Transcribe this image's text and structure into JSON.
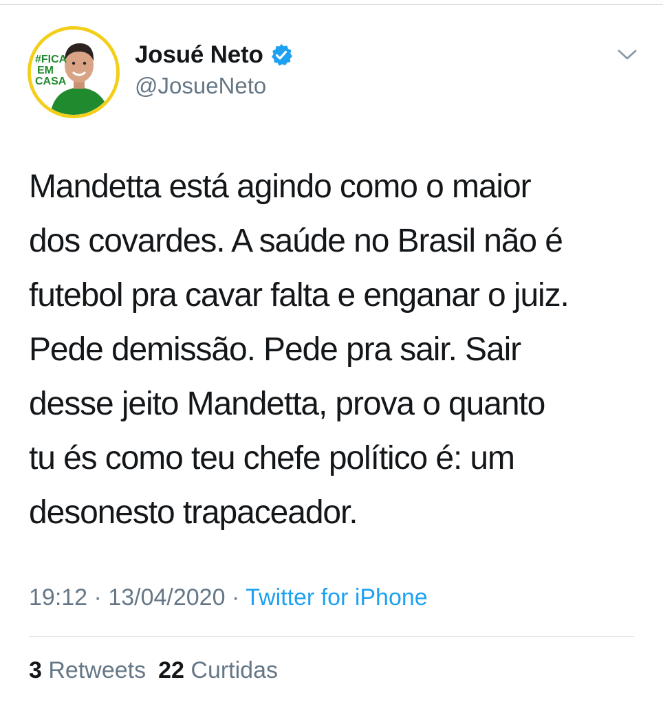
{
  "author": {
    "display_name": "Josué Neto",
    "handle": "@JosueNeto",
    "verified": true,
    "avatar_text": [
      "#FICA",
      "EM",
      "CASA"
    ]
  },
  "tweet": {
    "text": "Mandetta está agindo como o maior dos covardes. A saúde no Brasil não é futebol pra cavar falta e enganar o juiz. Pede demissão. Pede pra sair. Sair desse jeito Mandetta, prova o quanto tu és como teu chefe político é: um desonesto trapaceador.",
    "lines": [
      "Mandetta está agindo como o maior",
      "dos covardes. A saúde no Brasil não é",
      "futebol pra cavar falta e enganar o juiz.",
      "Pede demissão. Pede pra sair. Sair",
      "desse jeito Mandetta, prova o quanto",
      "tu és como teu chefe político é: um",
      "desonesto trapaceador."
    ],
    "time": "19:12",
    "date": "13/04/2020",
    "separator": "·",
    "source": "Twitter for iPhone"
  },
  "stats": {
    "retweets_count": "3",
    "retweets_label": "Retweets",
    "likes_count": "22",
    "likes_label": "Curtidas"
  },
  "colors": {
    "text_primary": "#14171a",
    "text_secondary": "#657786",
    "link_blue": "#1da1f2",
    "verified_blue": "#1da1f2",
    "avatar_ring": "#f3cf1c",
    "avatar_green": "#1f8a2e"
  },
  "icons": {
    "verified": "verified-badge-icon",
    "menu": "chevron-down-icon"
  }
}
